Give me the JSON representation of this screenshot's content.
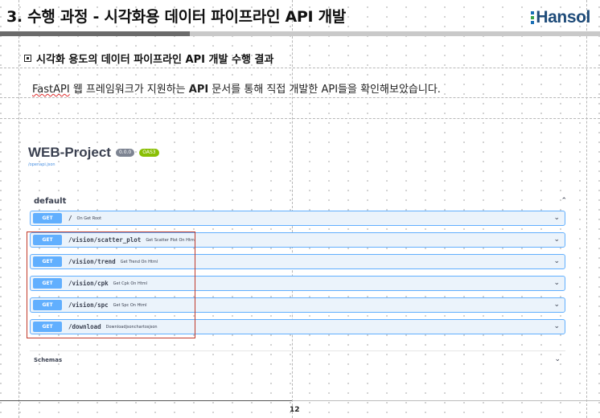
{
  "slide": {
    "title": "3. 수행 과정 - 시각화용 데이터 파이프라인 API 개발",
    "logo_text": "Hansol",
    "section_heading": "시각화 용도의 데이터 파이프라인 API 개발 수행 결과",
    "body_text_part1": "FastAPI",
    "body_text_part2": " 웹 프레임워크가 지원하는 ",
    "body_text_bold": "API",
    "body_text_part3": " 문서를 통해 직접 개발한 API들을 확인해보았습니다.",
    "page_number": "12"
  },
  "swagger": {
    "project_title": "WEB-Project",
    "version_badge": "0.0.0",
    "oas_badge": "OAS3",
    "openapi_link": "/openapi.json",
    "tag_name": "default",
    "operations": [
      {
        "method": "GET",
        "path": "/",
        "summary": "On Get Root"
      },
      {
        "method": "GET",
        "path": "/vision/scatter_plot",
        "summary": "Get Scatter Plot On Html"
      },
      {
        "method": "GET",
        "path": "/vision/trend",
        "summary": "Get Trend On Html"
      },
      {
        "method": "GET",
        "path": "/vision/cpk",
        "summary": "Get Cpk On Html"
      },
      {
        "method": "GET",
        "path": "/vision/spc",
        "summary": "Get Spc On Html"
      },
      {
        "method": "GET",
        "path": "/download",
        "summary": "Downloadjsonchartosjson"
      }
    ],
    "schemas_label": "Schemas"
  },
  "colors": {
    "get_method": "#61affe",
    "get_background": "#ebf3fb",
    "highlight_box": "#c0392b",
    "logo_blue": "#1f4c7a"
  },
  "icons": {
    "section_bullet": "square-bullet-icon",
    "collapse": "chevron-up-icon",
    "expand": "chevron-down-icon"
  }
}
